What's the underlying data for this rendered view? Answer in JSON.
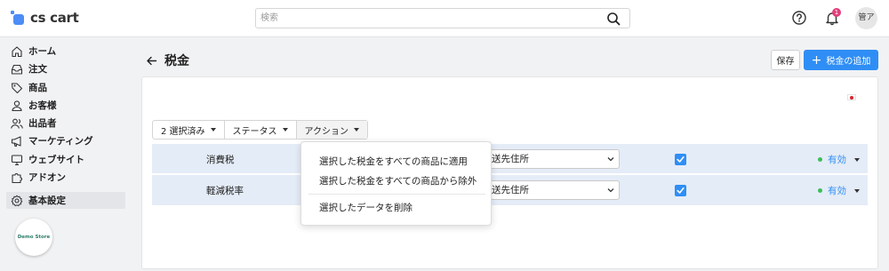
{
  "app": {
    "logo_text": "cs cart"
  },
  "search": {
    "placeholder": "検索",
    "value": ""
  },
  "header": {
    "help_icon": "question-circle-icon",
    "notifications_icon": "bell-icon",
    "notifications_count": "1",
    "user_initials": "管ア"
  },
  "sidebar": {
    "items": [
      {
        "label": "ホーム",
        "icon": "home-icon"
      },
      {
        "label": "注文",
        "icon": "inbox-icon"
      },
      {
        "label": "商品",
        "icon": "tag-icon"
      },
      {
        "label": "お客様",
        "icon": "user-icon"
      },
      {
        "label": "出品者",
        "icon": "users-icon"
      },
      {
        "label": "マーケティング",
        "icon": "megaphone-icon"
      },
      {
        "label": "ウェブサイト",
        "icon": "monitor-icon"
      },
      {
        "label": "アドオン",
        "icon": "puzzle-icon"
      },
      {
        "label": "基本設定",
        "icon": "gear-icon",
        "active": true
      }
    ],
    "store_badge": "Demo Store"
  },
  "page": {
    "title": "税金",
    "save_label": "保存",
    "add_label": "税金の追加"
  },
  "toolbar": {
    "selected_label": "2 選択済み",
    "status_label": "ステータス",
    "actions_label": "アクション"
  },
  "actions_menu": {
    "items": [
      "選択した税金をすべての商品に適用",
      "選択した税金をすべての商品から除外",
      "選択したデータを削除"
    ]
  },
  "rows": [
    {
      "name": "消費税",
      "address": "送先住所",
      "checked": true,
      "status": "有効"
    },
    {
      "name": "軽減税率",
      "address": "送先住所",
      "checked": true,
      "status": "有効"
    }
  ],
  "colors": {
    "accent": "#2f8ef5",
    "status_active": "#3ebd5a",
    "row_selected": "#e4ecf7",
    "badge": "#e0407b"
  }
}
